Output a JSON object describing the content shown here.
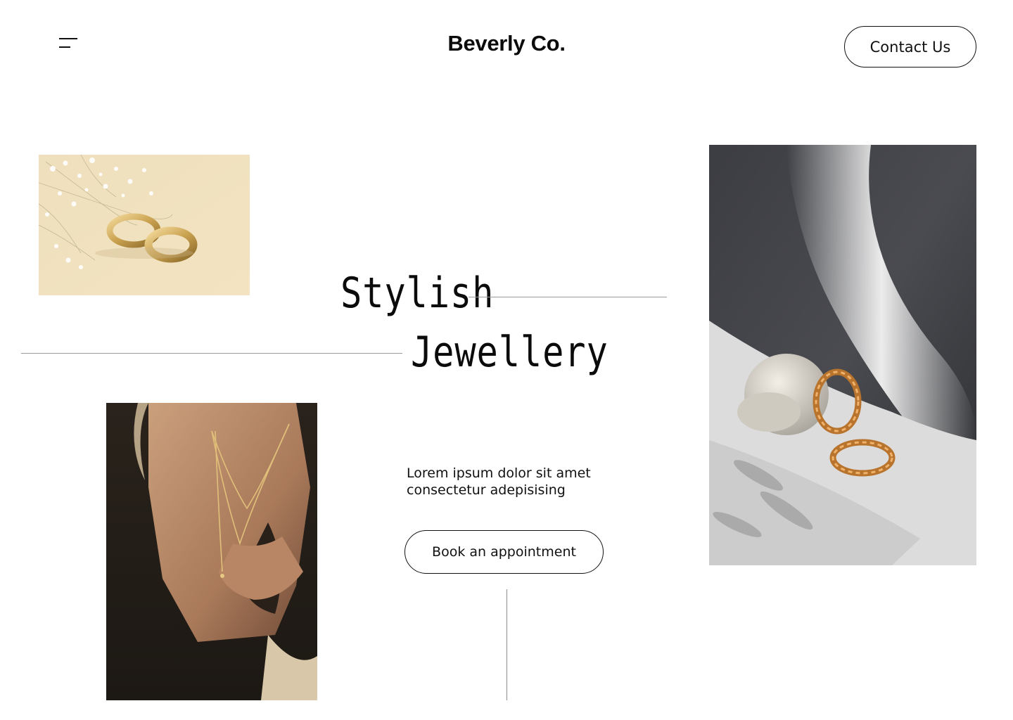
{
  "header": {
    "brand": "Beverly Co.",
    "contact_label": "Contact Us",
    "menu_icon": "hamburger-menu-icon"
  },
  "hero": {
    "headline_line1": "Stylish",
    "headline_line2": "Jewellery",
    "tagline_line1": "Lorem ipsum dolor sit amet",
    "tagline_line2": "consectetur adepisising",
    "cta_label": "Book an appointment"
  },
  "colors": {
    "background": "#ffffff",
    "text": "#111111",
    "divider": "#9a9a9a"
  }
}
